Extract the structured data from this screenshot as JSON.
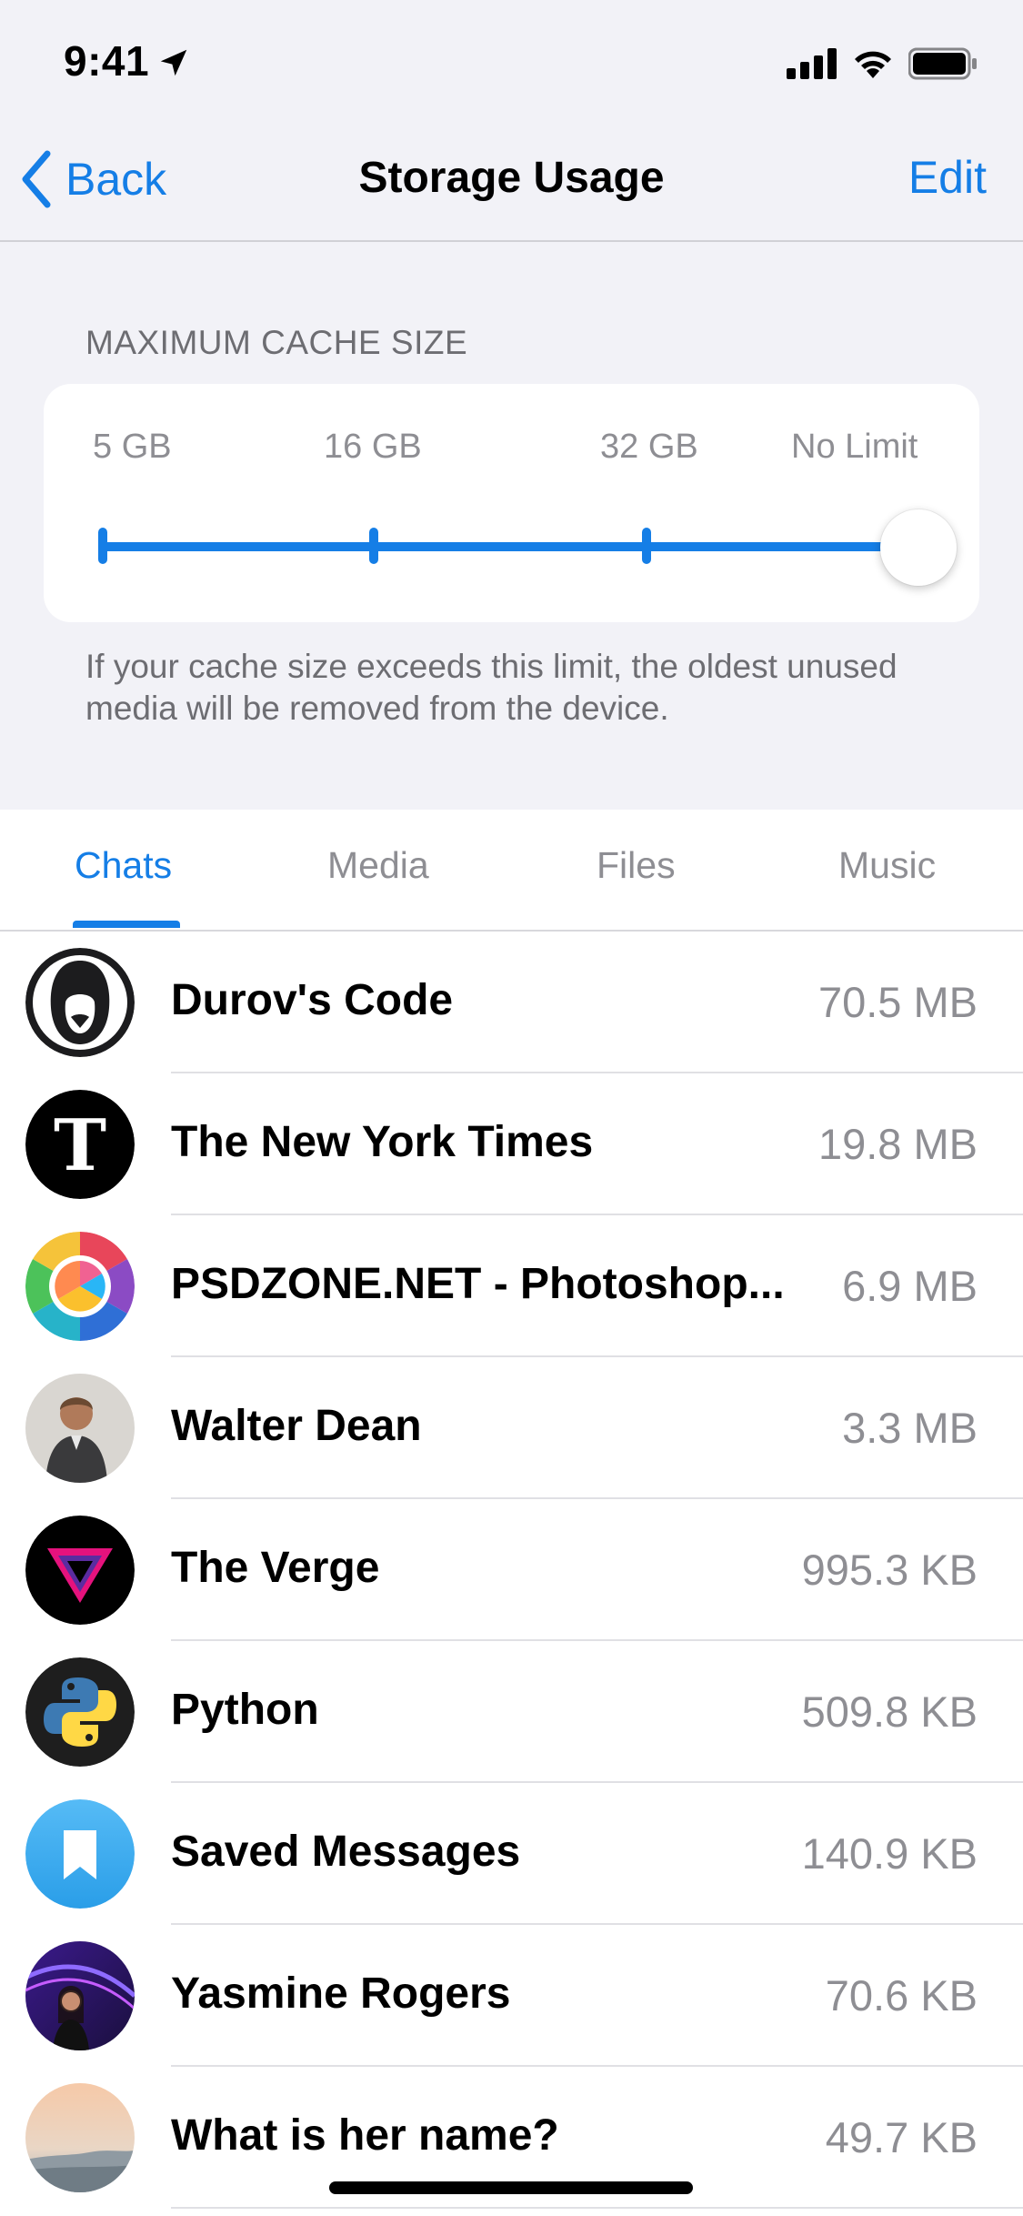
{
  "status_bar": {
    "time": "9:41"
  },
  "nav": {
    "back_label": "Back",
    "title": "Storage Usage",
    "edit_label": "Edit"
  },
  "cache": {
    "section_title": "MAXIMUM CACHE SIZE",
    "options": [
      "5 GB",
      "16 GB",
      "32 GB",
      "No Limit"
    ],
    "selected": "No Limit",
    "footer": "If your cache size exceeds this limit, the oldest unused media will be removed from the device."
  },
  "tabs": [
    {
      "label": "Chats",
      "active": true
    },
    {
      "label": "Media",
      "active": false
    },
    {
      "label": "Files",
      "active": false
    },
    {
      "label": "Music",
      "active": false
    }
  ],
  "chats": [
    {
      "name": "Durov's Code",
      "size": "70.5 MB",
      "avatar": "durovs-code-avatar"
    },
    {
      "name": "The New York Times",
      "size": "19.8 MB",
      "avatar": "nyt-avatar"
    },
    {
      "name": "PSDZONE.NET - Photoshop...",
      "size": "6.9 MB",
      "avatar": "psdzone-avatar"
    },
    {
      "name": "Walter Dean",
      "size": "3.3 MB",
      "avatar": "walter-dean-avatar"
    },
    {
      "name": "The Verge",
      "size": "995.3 KB",
      "avatar": "the-verge-avatar"
    },
    {
      "name": "Python",
      "size": "509.8 KB",
      "avatar": "python-avatar"
    },
    {
      "name": "Saved Messages",
      "size": "140.9 KB",
      "avatar": "saved-messages-avatar"
    },
    {
      "name": "Yasmine Rogers",
      "size": "70.6 KB",
      "avatar": "yasmine-rogers-avatar"
    },
    {
      "name": "What is her name?",
      "size": "49.7 KB",
      "avatar": "what-is-her-name-avatar"
    }
  ],
  "colors": {
    "accent": "#157ee6",
    "secondary_text": "#8e8e93",
    "grouped_bg": "#f2f2f7"
  }
}
